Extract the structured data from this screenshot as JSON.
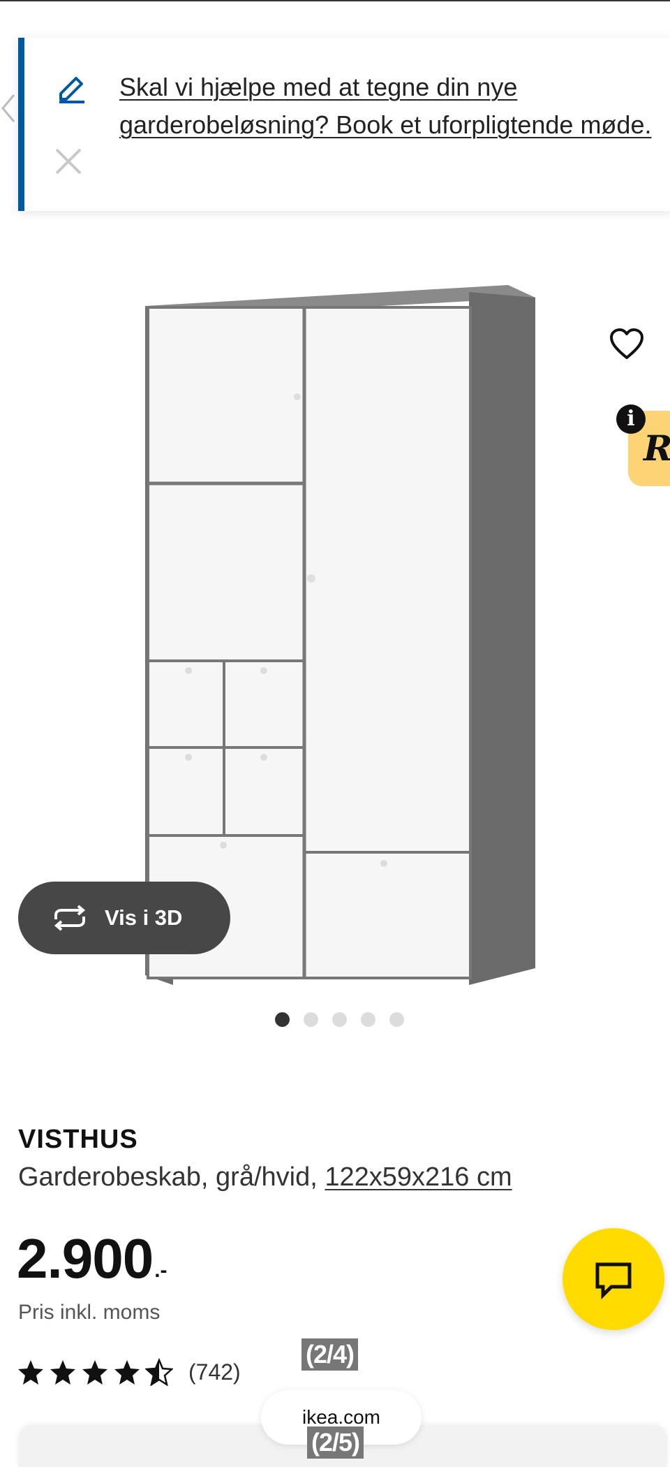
{
  "banner": {
    "message": "Skal vi hjælpe med at tegne din nye garderobeløsning? Book et uforpligtende møde."
  },
  "gallery": {
    "view_3d_label": "Vis i 3D",
    "image_count": 5,
    "active_index": 0
  },
  "product": {
    "name": "VISTHUS",
    "description": "Garderobeskab, grå/hvid, ",
    "dimensions": "122x59x216 cm",
    "price": "2.900",
    "price_suffix": ".-",
    "price_note": "Pris inkl. moms",
    "rating": {
      "stars": 4.5,
      "count": "(742)"
    }
  },
  "overlay": {
    "page_counter_top": "(2/4)",
    "page_counter_bottom": "(2/5)",
    "url": "ikea.com"
  },
  "colors": {
    "brand_blue": "#0058a3",
    "chat_yellow": "#ffdb00",
    "badge_yellow": "#fcd475",
    "button_dark": "#474747"
  },
  "icons": [
    "pencil-icon",
    "close-icon",
    "chevron-left-icon",
    "heart-icon",
    "info-icon",
    "rotate-3d-icon",
    "chat-icon",
    "star-icon"
  ]
}
